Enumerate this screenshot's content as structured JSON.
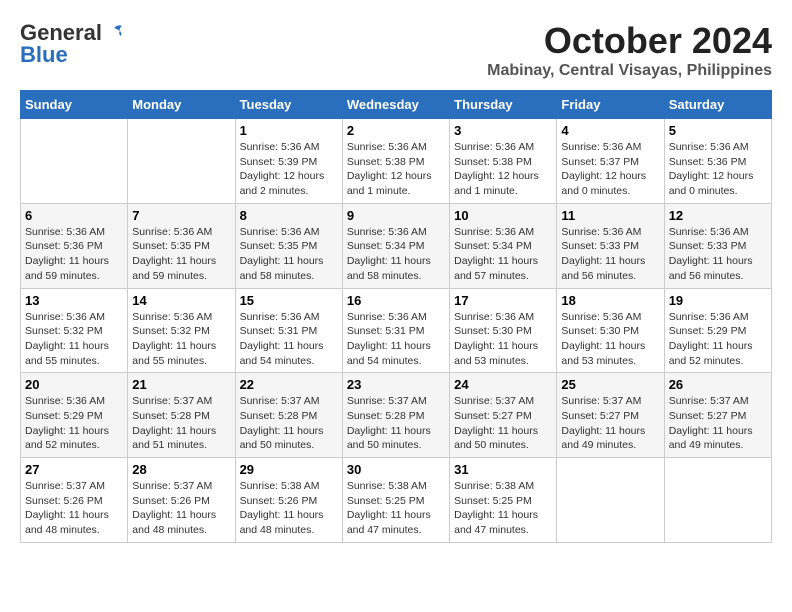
{
  "header": {
    "logo_line1": "General",
    "logo_line2": "Blue",
    "month": "October 2024",
    "location": "Mabinay, Central Visayas, Philippines"
  },
  "weekdays": [
    "Sunday",
    "Monday",
    "Tuesday",
    "Wednesday",
    "Thursday",
    "Friday",
    "Saturday"
  ],
  "weeks": [
    [
      null,
      null,
      {
        "day": 1,
        "sunrise": "Sunrise: 5:36 AM",
        "sunset": "Sunset: 5:39 PM",
        "daylight": "Daylight: 12 hours and 2 minutes."
      },
      {
        "day": 2,
        "sunrise": "Sunrise: 5:36 AM",
        "sunset": "Sunset: 5:38 PM",
        "daylight": "Daylight: 12 hours and 1 minute."
      },
      {
        "day": 3,
        "sunrise": "Sunrise: 5:36 AM",
        "sunset": "Sunset: 5:38 PM",
        "daylight": "Daylight: 12 hours and 1 minute."
      },
      {
        "day": 4,
        "sunrise": "Sunrise: 5:36 AM",
        "sunset": "Sunset: 5:37 PM",
        "daylight": "Daylight: 12 hours and 0 minutes."
      },
      {
        "day": 5,
        "sunrise": "Sunrise: 5:36 AM",
        "sunset": "Sunset: 5:36 PM",
        "daylight": "Daylight: 12 hours and 0 minutes."
      }
    ],
    [
      {
        "day": 6,
        "sunrise": "Sunrise: 5:36 AM",
        "sunset": "Sunset: 5:36 PM",
        "daylight": "Daylight: 11 hours and 59 minutes."
      },
      {
        "day": 7,
        "sunrise": "Sunrise: 5:36 AM",
        "sunset": "Sunset: 5:35 PM",
        "daylight": "Daylight: 11 hours and 59 minutes."
      },
      {
        "day": 8,
        "sunrise": "Sunrise: 5:36 AM",
        "sunset": "Sunset: 5:35 PM",
        "daylight": "Daylight: 11 hours and 58 minutes."
      },
      {
        "day": 9,
        "sunrise": "Sunrise: 5:36 AM",
        "sunset": "Sunset: 5:34 PM",
        "daylight": "Daylight: 11 hours and 58 minutes."
      },
      {
        "day": 10,
        "sunrise": "Sunrise: 5:36 AM",
        "sunset": "Sunset: 5:34 PM",
        "daylight": "Daylight: 11 hours and 57 minutes."
      },
      {
        "day": 11,
        "sunrise": "Sunrise: 5:36 AM",
        "sunset": "Sunset: 5:33 PM",
        "daylight": "Daylight: 11 hours and 56 minutes."
      },
      {
        "day": 12,
        "sunrise": "Sunrise: 5:36 AM",
        "sunset": "Sunset: 5:33 PM",
        "daylight": "Daylight: 11 hours and 56 minutes."
      }
    ],
    [
      {
        "day": 13,
        "sunrise": "Sunrise: 5:36 AM",
        "sunset": "Sunset: 5:32 PM",
        "daylight": "Daylight: 11 hours and 55 minutes."
      },
      {
        "day": 14,
        "sunrise": "Sunrise: 5:36 AM",
        "sunset": "Sunset: 5:32 PM",
        "daylight": "Daylight: 11 hours and 55 minutes."
      },
      {
        "day": 15,
        "sunrise": "Sunrise: 5:36 AM",
        "sunset": "Sunset: 5:31 PM",
        "daylight": "Daylight: 11 hours and 54 minutes."
      },
      {
        "day": 16,
        "sunrise": "Sunrise: 5:36 AM",
        "sunset": "Sunset: 5:31 PM",
        "daylight": "Daylight: 11 hours and 54 minutes."
      },
      {
        "day": 17,
        "sunrise": "Sunrise: 5:36 AM",
        "sunset": "Sunset: 5:30 PM",
        "daylight": "Daylight: 11 hours and 53 minutes."
      },
      {
        "day": 18,
        "sunrise": "Sunrise: 5:36 AM",
        "sunset": "Sunset: 5:30 PM",
        "daylight": "Daylight: 11 hours and 53 minutes."
      },
      {
        "day": 19,
        "sunrise": "Sunrise: 5:36 AM",
        "sunset": "Sunset: 5:29 PM",
        "daylight": "Daylight: 11 hours and 52 minutes."
      }
    ],
    [
      {
        "day": 20,
        "sunrise": "Sunrise: 5:36 AM",
        "sunset": "Sunset: 5:29 PM",
        "daylight": "Daylight: 11 hours and 52 minutes."
      },
      {
        "day": 21,
        "sunrise": "Sunrise: 5:37 AM",
        "sunset": "Sunset: 5:28 PM",
        "daylight": "Daylight: 11 hours and 51 minutes."
      },
      {
        "day": 22,
        "sunrise": "Sunrise: 5:37 AM",
        "sunset": "Sunset: 5:28 PM",
        "daylight": "Daylight: 11 hours and 50 minutes."
      },
      {
        "day": 23,
        "sunrise": "Sunrise: 5:37 AM",
        "sunset": "Sunset: 5:28 PM",
        "daylight": "Daylight: 11 hours and 50 minutes."
      },
      {
        "day": 24,
        "sunrise": "Sunrise: 5:37 AM",
        "sunset": "Sunset: 5:27 PM",
        "daylight": "Daylight: 11 hours and 50 minutes."
      },
      {
        "day": 25,
        "sunrise": "Sunrise: 5:37 AM",
        "sunset": "Sunset: 5:27 PM",
        "daylight": "Daylight: 11 hours and 49 minutes."
      },
      {
        "day": 26,
        "sunrise": "Sunrise: 5:37 AM",
        "sunset": "Sunset: 5:27 PM",
        "daylight": "Daylight: 11 hours and 49 minutes."
      }
    ],
    [
      {
        "day": 27,
        "sunrise": "Sunrise: 5:37 AM",
        "sunset": "Sunset: 5:26 PM",
        "daylight": "Daylight: 11 hours and 48 minutes."
      },
      {
        "day": 28,
        "sunrise": "Sunrise: 5:37 AM",
        "sunset": "Sunset: 5:26 PM",
        "daylight": "Daylight: 11 hours and 48 minutes."
      },
      {
        "day": 29,
        "sunrise": "Sunrise: 5:38 AM",
        "sunset": "Sunset: 5:26 PM",
        "daylight": "Daylight: 11 hours and 48 minutes."
      },
      {
        "day": 30,
        "sunrise": "Sunrise: 5:38 AM",
        "sunset": "Sunset: 5:25 PM",
        "daylight": "Daylight: 11 hours and 47 minutes."
      },
      {
        "day": 31,
        "sunrise": "Sunrise: 5:38 AM",
        "sunset": "Sunset: 5:25 PM",
        "daylight": "Daylight: 11 hours and 47 minutes."
      },
      null,
      null
    ]
  ]
}
